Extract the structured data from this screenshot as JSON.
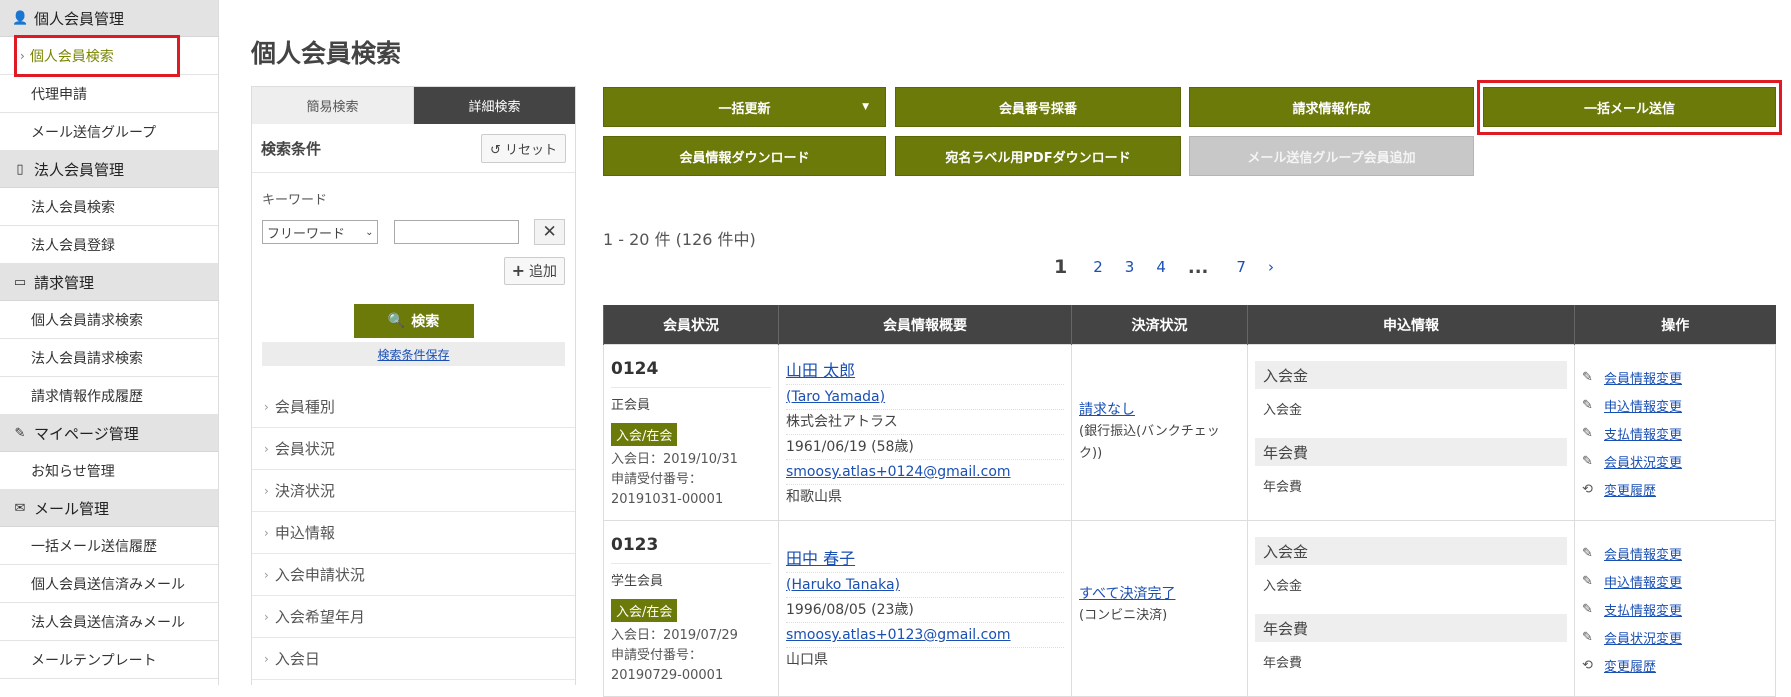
{
  "sidebar": {
    "sections": [
      {
        "title": "個人会員管理",
        "icon": "person-icon",
        "items": [
          "個人会員検索",
          "代理申請",
          "メール送信グループ"
        ]
      },
      {
        "title": "法人会員管理",
        "icon": "building-icon",
        "items": [
          "法人会員検索",
          "法人会員登録"
        ]
      },
      {
        "title": "請求管理",
        "icon": "document-icon",
        "items": [
          "個人会員請求検索",
          "法人会員請求検索",
          "請求情報作成履歴"
        ]
      },
      {
        "title": "マイページ管理",
        "icon": "pencil-icon",
        "items": [
          "お知らせ管理"
        ]
      },
      {
        "title": "メール管理",
        "icon": "envelope-icon",
        "items": [
          "一括メール送信履歴",
          "個人会員送信済みメール",
          "法人会員送信済みメール",
          "メールテンプレート"
        ]
      }
    ]
  },
  "page": {
    "title": "個人会員検索"
  },
  "search": {
    "tabs": {
      "simple": "簡易検索",
      "detail": "詳細検索"
    },
    "conditions_label": "検索条件",
    "reset_label": "リセット",
    "keyword_label": "キーワード",
    "keyword_select_value": "フリーワード",
    "add_label": "追加",
    "search_label": "検索",
    "save_link": "検索条件保存",
    "filters": [
      "会員種別",
      "会員状況",
      "決済状況",
      "申込情報",
      "入会申請状況",
      "入会希望年月",
      "入会日"
    ]
  },
  "actions": {
    "bulk_update": "一括更新",
    "assign_number": "会員番号採番",
    "create_invoice": "請求情報作成",
    "bulk_mail": "一括メール送信",
    "download_info": "会員情報ダウンロード",
    "label_pdf": "宛名ラベル用PDFダウンロード",
    "add_mail_group": "メール送信グループ会員追加"
  },
  "results": {
    "count_text": "1 - 20 件 (126 件中)",
    "pager": {
      "current": "1",
      "pages": [
        "2",
        "3",
        "4"
      ],
      "dots": "...",
      "last": "7",
      "next": "›"
    },
    "columns": [
      "会員状況",
      "会員情報概要",
      "決済状況",
      "申込情報",
      "操作"
    ],
    "rows": [
      {
        "number": "0124",
        "type": "正会員",
        "status": "入会/在会",
        "joined": "入会日：2019/10/31",
        "app_no_label": "申請受付番号：",
        "app_no": "20191031-00001",
        "name": "山田 太郎",
        "name_en": "(Taro Yamada)",
        "company": "株式会社アトラス",
        "birth": "1961/06/19 (58歳)",
        "email": "smoosy.atlas+0124@gmail.com",
        "pref": "和歌山県",
        "payment_status": "請求なし",
        "payment_method": "(銀行振込(バンクチェック))",
        "apply": [
          {
            "head": "入会金",
            "value": "入会金"
          },
          {
            "head": "年会費",
            "value": "年会費"
          }
        ]
      },
      {
        "number": "0123",
        "type": "学生会員",
        "status": "入会/在会",
        "joined": "入会日：2019/07/29",
        "app_no_label": "申請受付番号：",
        "app_no": "20190729-00001",
        "name": "田中 春子",
        "name_en": "(Haruko Tanaka)",
        "company": "",
        "birth": "1996/08/05 (23歳)",
        "email": "smoosy.atlas+0123@gmail.com",
        "pref": "山口県",
        "payment_status": "すべて決済完了",
        "payment_method": "(コンビニ決済)",
        "apply": [
          {
            "head": "入会金",
            "value": "入会金"
          },
          {
            "head": "年会費",
            "value": "年会費"
          }
        ]
      }
    ],
    "operations": [
      "会員情報変更",
      "申込情報変更",
      "支払情報変更",
      "会員状況変更",
      "変更履歴"
    ]
  },
  "colors": {
    "accent": "#6c7a0a",
    "header": "#444444",
    "highlight_box": "#e01a22",
    "link": "#1a4fb3"
  }
}
